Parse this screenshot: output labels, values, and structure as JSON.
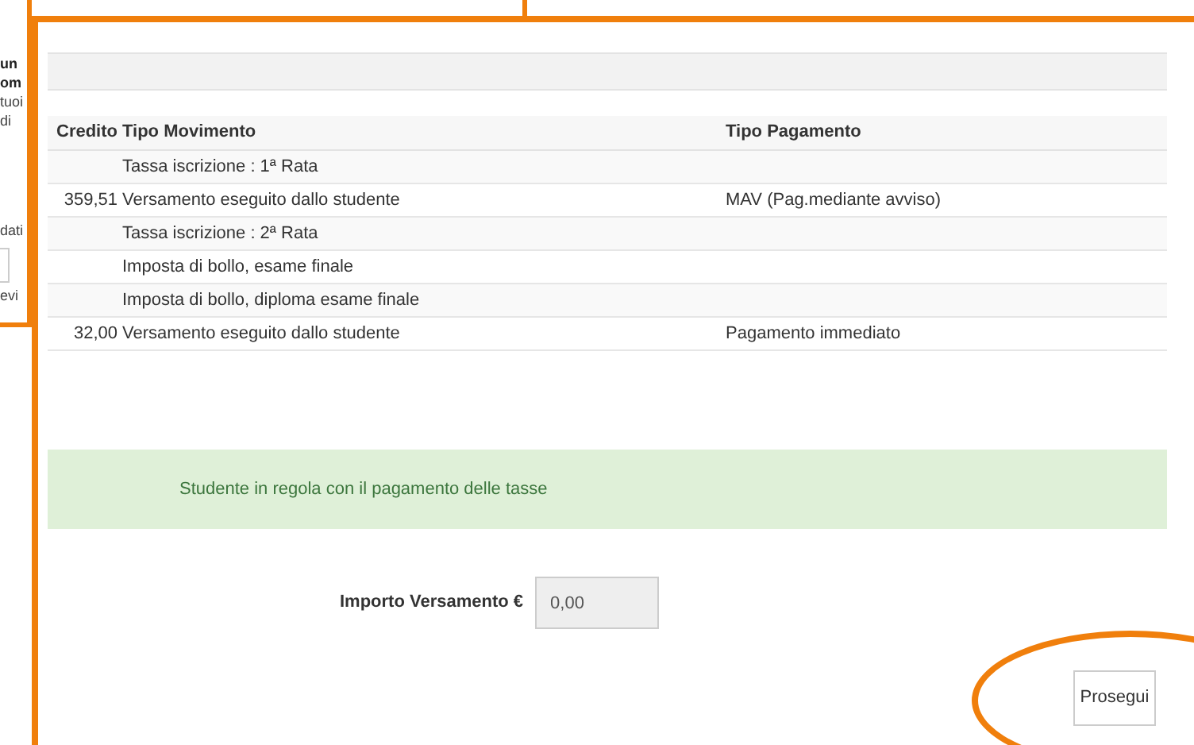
{
  "background_page": {
    "fragments": [
      {
        "text": "un",
        "kind": "bold"
      },
      {
        "text": "om",
        "kind": "bold"
      },
      {
        "text": "tuoi",
        "kind": "plain"
      },
      {
        "text": "di",
        "kind": "plain"
      },
      {
        "text": "dati",
        "kind": "plain"
      },
      {
        "text": "evi",
        "kind": "plain"
      }
    ]
  },
  "payments_table": {
    "columns": [
      "Credito",
      "Tipo Movimento",
      "Tipo Pagamento"
    ],
    "rows": [
      {
        "tipo_movimento": "Tassa iscrizione : 1ª Rata"
      },
      {
        "credito": "359,51",
        "tipo_movimento": "Versamento eseguito dallo studente",
        "tipo_pagamento": "MAV (Pag.mediante avviso)"
      },
      {
        "tipo_movimento": "Tassa iscrizione : 2ª Rata"
      },
      {
        "tipo_movimento": "Imposta di bollo, esame finale"
      },
      {
        "tipo_movimento": "Imposta di bollo, diploma esame finale"
      },
      {
        "credito": "32,00",
        "tipo_movimento": "Versamento eseguito dallo studente",
        "tipo_pagamento": "Pagamento immediato"
      }
    ]
  },
  "status_alert": {
    "text": "Studente in regola con il pagamento delle tasse"
  },
  "amount_field": {
    "label": "Importo Versamento €",
    "value": "0,00"
  },
  "buttons": [
    "Prosegui"
  ]
}
